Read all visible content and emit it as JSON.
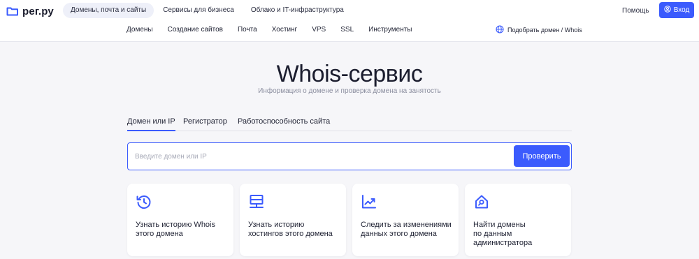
{
  "header": {
    "logo_text": "рег.ру",
    "top_nav": [
      {
        "label": "Домены, почта и сайты",
        "active": true
      },
      {
        "label": "Сервисы для бизнеса",
        "active": false
      },
      {
        "label": "Облако и IT-инфраструктура",
        "active": false
      }
    ],
    "help_label": "Помощь",
    "login_label": "Вход",
    "sub_nav": [
      "Домены",
      "Создание сайтов",
      "Почта",
      "Хостинг",
      "VPS",
      "SSL",
      "Инструменты"
    ],
    "domain_picker_label": "Подобрать домен / Whois"
  },
  "main": {
    "title": "Whois-сервис",
    "subtitle": "Информация о домене и проверка домена на занятость",
    "tabs": [
      {
        "label": "Домен или IP",
        "active": true
      },
      {
        "label": "Регистратор",
        "active": false
      },
      {
        "label": "Работоспособность сайта",
        "active": false
      }
    ],
    "search": {
      "placeholder": "Введите домен или IP",
      "value": "",
      "button_label": "Проверить"
    },
    "cards": [
      {
        "icon": "history-clock-icon",
        "label": "Узнать историю Whois\nэтого домена"
      },
      {
        "icon": "server-icon",
        "label": "Узнать историю\nхостингов этого домена"
      },
      {
        "icon": "trend-chart-icon",
        "label": "Следить за изменениями\nданных этого домена"
      },
      {
        "icon": "home-search-icon",
        "label": "Найти домены\nпо данным\nадминистратора"
      }
    ]
  },
  "colors": {
    "accent": "#3b5bfd",
    "text": "#1f2233",
    "muted": "#8b8e9f",
    "background": "#f6f6f9",
    "active_nav_bg": "#eef0f9"
  }
}
